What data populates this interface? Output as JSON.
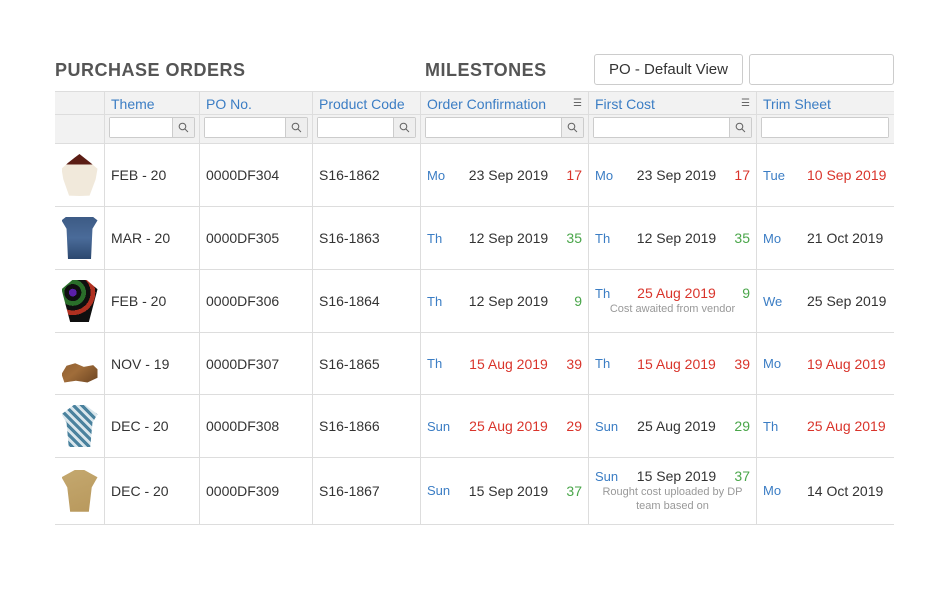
{
  "header": {
    "purchase_orders": "PURCHASE ORDERS",
    "milestones": "MILESTONES",
    "view_selected": "PO - Default View"
  },
  "columns": {
    "theme": "Theme",
    "po_no": "PO No.",
    "product_code": "Product Code",
    "order_confirmation": "Order Confirmation",
    "first_cost": "First Cost",
    "trim_sheet": "Trim Sheet"
  },
  "rows": [
    {
      "theme": "FEB - 20",
      "po": "0000DF304",
      "product": "S16-1862",
      "order": {
        "day": "Mo",
        "date": "23 Sep 2019",
        "date_red": false,
        "count": "17",
        "count_color": "red"
      },
      "first": {
        "day": "Mo",
        "date": "23 Sep 2019",
        "date_red": false,
        "count": "17",
        "count_color": "red",
        "note": ""
      },
      "trim": {
        "day": "Tue",
        "date": "10 Sep 2019",
        "date_red": true
      }
    },
    {
      "theme": "MAR - 20",
      "po": "0000DF305",
      "product": "S16-1863",
      "order": {
        "day": "Th",
        "date": "12 Sep 2019",
        "date_red": false,
        "count": "35",
        "count_color": "green"
      },
      "first": {
        "day": "Th",
        "date": "12 Sep 2019",
        "date_red": false,
        "count": "35",
        "count_color": "green",
        "note": ""
      },
      "trim": {
        "day": "Mo",
        "date": "21 Oct 2019",
        "date_red": false
      }
    },
    {
      "theme": "FEB - 20",
      "po": "0000DF306",
      "product": "S16-1864",
      "order": {
        "day": "Th",
        "date": "12 Sep 2019",
        "date_red": false,
        "count": "9",
        "count_color": "green"
      },
      "first": {
        "day": "Th",
        "date": "25 Aug 2019",
        "date_red": true,
        "count": "9",
        "count_color": "green",
        "note": "Cost awaited from vendor"
      },
      "trim": {
        "day": "We",
        "date": "25 Sep 2019",
        "date_red": false
      }
    },
    {
      "theme": "NOV - 19",
      "po": "0000DF307",
      "product": "S16-1865",
      "order": {
        "day": "Th",
        "date": "15 Aug 2019",
        "date_red": true,
        "count": "39",
        "count_color": "red"
      },
      "first": {
        "day": "Th",
        "date": "15 Aug 2019",
        "date_red": true,
        "count": "39",
        "count_color": "red",
        "note": ""
      },
      "trim": {
        "day": "Mo",
        "date": "19 Aug 2019",
        "date_red": true
      }
    },
    {
      "theme": "DEC - 20",
      "po": "0000DF308",
      "product": "S16-1866",
      "order": {
        "day": "Sun",
        "date": "25 Aug 2019",
        "date_red": true,
        "count": "29",
        "count_color": "red"
      },
      "first": {
        "day": "Sun",
        "date": "25 Aug 2019",
        "date_red": false,
        "count": "29",
        "count_color": "green",
        "note": ""
      },
      "trim": {
        "day": "Th",
        "date": "25 Aug 2019",
        "date_red": true
      }
    },
    {
      "theme": "DEC - 20",
      "po": "0000DF309",
      "product": "S16-1867",
      "order": {
        "day": "Sun",
        "date": "15 Sep 2019",
        "date_red": false,
        "count": "37",
        "count_color": "green"
      },
      "first": {
        "day": "Sun",
        "date": "15 Sep 2019",
        "date_red": false,
        "count": "37",
        "count_color": "green",
        "note": "Rought cost uploaded by DP team based on"
      },
      "trim": {
        "day": "Mo",
        "date": "14 Oct 2019",
        "date_red": false
      }
    }
  ]
}
